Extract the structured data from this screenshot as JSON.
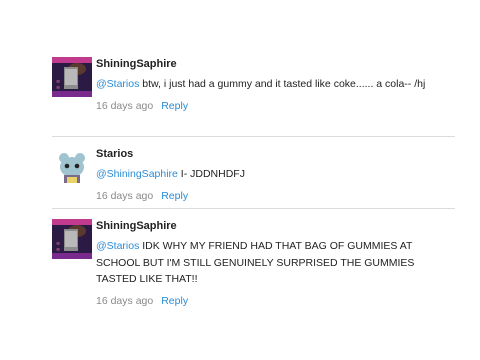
{
  "comments": [
    {
      "username": "ShiningSaphire",
      "mention": "@Starios",
      "text": " btw, i just had a gummy and it tasted like coke...... a cola-- /hj",
      "age": "16 days ago",
      "reply_label": "Reply"
    },
    {
      "username": "Starios",
      "mention": "@ShiningSaphire",
      "text": " I- JDDNHDFJ",
      "age": "16 days ago",
      "reply_label": "Reply"
    },
    {
      "username": "ShiningSaphire",
      "mention": "@Starios",
      "text": " IDK WHY MY FRIEND HAD THAT BAG OF GUMMIES AT SCHOOL BUT I'M STILL GENUINELY SURPRISED THE GUMMIES TASTED LIKE THAT!!",
      "age": "16 days ago",
      "reply_label": "Reply"
    }
  ],
  "colors": {
    "link": "#2a8cd6",
    "meta": "#8a8a8a",
    "divider": "#dcdcdc"
  }
}
